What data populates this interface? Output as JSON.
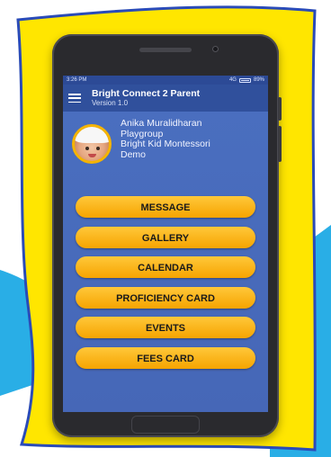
{
  "colors": {
    "background_blue": "#29aee6",
    "background_yellow": "#ffe600",
    "accent_orange": "#f6a400",
    "app_blue": "#30509c"
  },
  "status_bar": {
    "time": "3:26 PM",
    "network": "4G",
    "battery": "89%"
  },
  "app_bar": {
    "title": "Bright Connect 2 Parent",
    "version": "Version 1.0",
    "menu_icon": "hamburger-menu-icon"
  },
  "profile": {
    "avatar_icon": "child-avatar",
    "name": "Anika Muralidharan",
    "class": "Playgroup",
    "school_line1": "Bright Kid Montessori",
    "school_line2": "Demo"
  },
  "menu": [
    {
      "label": "MESSAGE"
    },
    {
      "label": "GALLERY"
    },
    {
      "label": "CALENDAR"
    },
    {
      "label": "PROFICIENCY CARD"
    },
    {
      "label": "EVENTS"
    },
    {
      "label": "FEES CARD"
    }
  ]
}
